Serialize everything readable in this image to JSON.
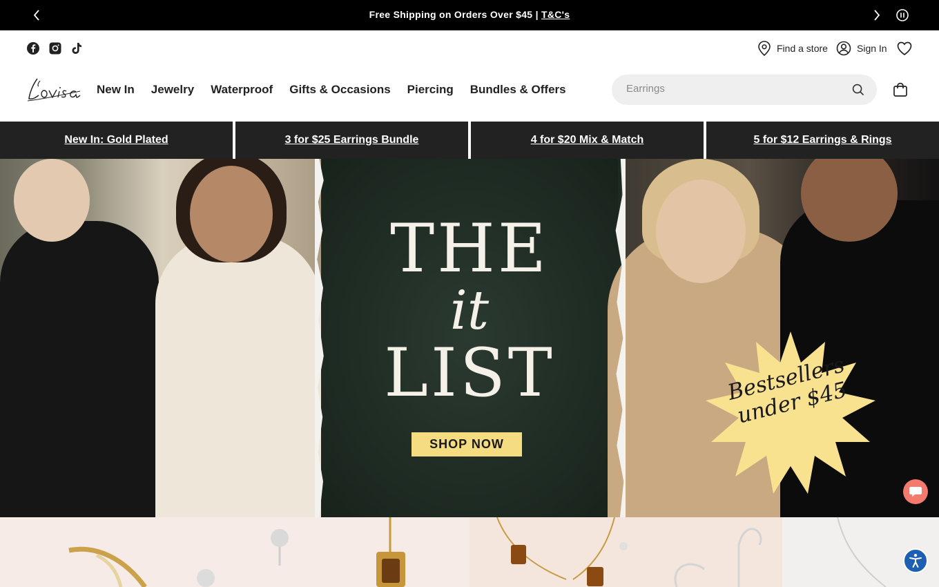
{
  "announcement": {
    "message": "Free Shipping on Orders Over $45 |",
    "link": "T&C's",
    "prev_icon": "chevron-left-icon",
    "next_icon": "chevron-right-icon",
    "pause_icon": "pause-icon"
  },
  "utility": {
    "social": [
      "facebook-icon",
      "instagram-icon",
      "tiktok-icon"
    ],
    "find_store": "Find a store",
    "sign_in": "Sign In",
    "wishlist_icon": "heart-icon"
  },
  "header": {
    "logo_text": "Lovisa",
    "nav": [
      "New In",
      "Jewelry",
      "Waterproof",
      "Gifts & Occasions",
      "Piercing",
      "Bundles & Offers"
    ],
    "search_placeholder": "Earrings",
    "bag_icon": "shopping-bag-icon"
  },
  "promos": [
    "New In: Gold Plated",
    "3 for $25 Earrings Bundle",
    "4 for $20 Mix & Match",
    "5 for $12 Earrings & Rings"
  ],
  "hero": {
    "line1": "THE",
    "line2": "it",
    "line3": "LIST",
    "cta": "SHOP NOW",
    "burst": "Bestsellers under $45",
    "burst_color": "#f8e18f"
  },
  "colors": {
    "announce_bg": "#000000",
    "promo_bg": "#222222",
    "cta_bg": "#f6dc80",
    "chat_bg": "#f47a6e",
    "accessibility_bg": "#1c5fb3"
  }
}
